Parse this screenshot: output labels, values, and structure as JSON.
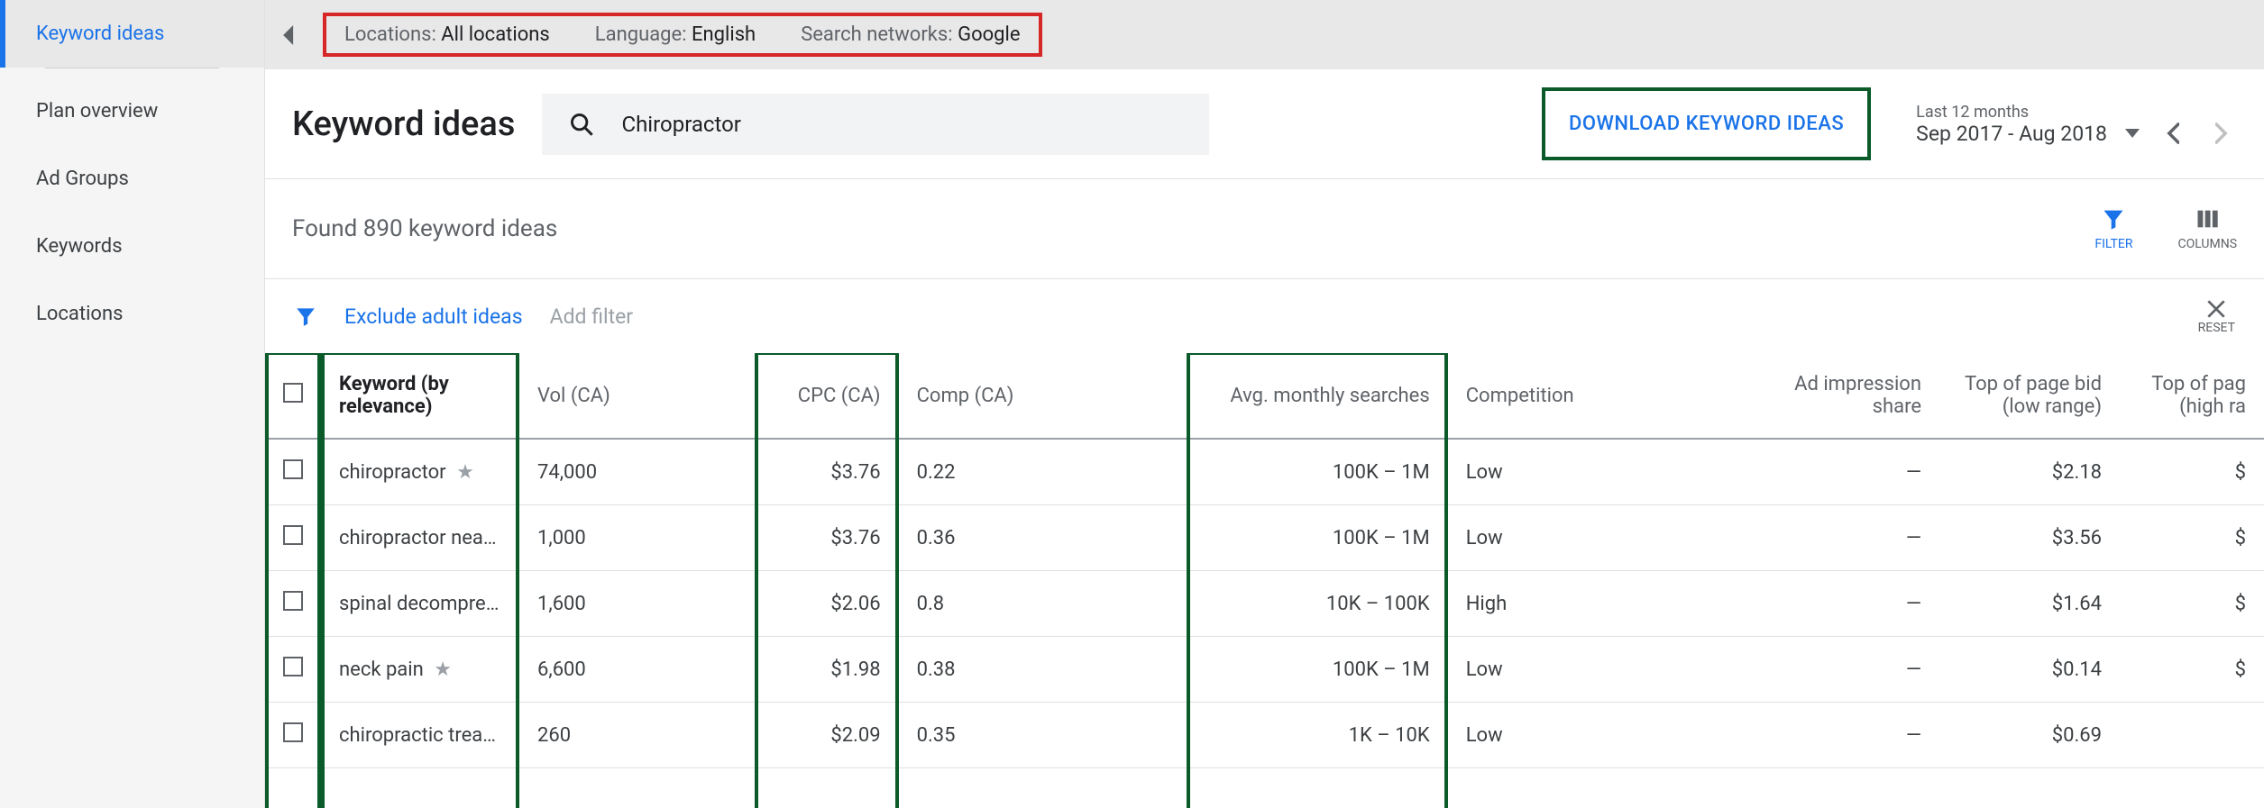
{
  "sidebar": {
    "items": [
      {
        "label": "Keyword ideas",
        "active": true
      },
      {
        "label": "Plan overview"
      },
      {
        "label": "Ad Groups"
      },
      {
        "label": "Keywords"
      },
      {
        "label": "Locations"
      }
    ]
  },
  "topbar": {
    "locations_label": "Locations:",
    "locations_value": "All locations",
    "language_label": "Language:",
    "language_value": "English",
    "networks_label": "Search networks:",
    "networks_value": "Google"
  },
  "header": {
    "page_title": "Keyword ideas",
    "search_value": "Chiropractor",
    "download_label": "DOWNLOAD KEYWORD IDEAS",
    "date_label": "Last 12 months",
    "date_range": "Sep 2017 - Aug 2018"
  },
  "found": {
    "text": "Found 890 keyword ideas",
    "filter_label": "FILTER",
    "columns_label": "COLUMNS"
  },
  "filterbar": {
    "exclude": "Exclude adult ideas",
    "add_filter": "Add filter",
    "reset": "RESET"
  },
  "table": {
    "columns": {
      "keyword": "Keyword (by relevance)",
      "vol": "Vol (CA)",
      "cpc": "CPC (CA)",
      "comp": "Comp (CA)",
      "avg": "Avg. monthly searches",
      "competition": "Competition",
      "impression": "Ad impression share",
      "top_low": "Top of page bid (low range)",
      "top_high": "Top of pag (high ra"
    },
    "rows": [
      {
        "keyword": "chiropractor",
        "star": true,
        "vol": "74,000",
        "cpc": "$3.76",
        "comp": "0.22",
        "avg": "100K – 1M",
        "competition": "Low",
        "impression": "—",
        "top_low": "$2.18",
        "top_high": "$"
      },
      {
        "keyword": "chiropractor near …",
        "star": false,
        "vol": "1,000",
        "cpc": "$3.76",
        "comp": "0.36",
        "avg": "100K – 1M",
        "competition": "Low",
        "impression": "—",
        "top_low": "$3.56",
        "top_high": "$"
      },
      {
        "keyword": "spinal decompres…",
        "star": false,
        "vol": "1,600",
        "cpc": "$2.06",
        "comp": "0.8",
        "avg": "10K – 100K",
        "competition": "High",
        "impression": "—",
        "top_low": "$1.64",
        "top_high": "$"
      },
      {
        "keyword": "neck pain",
        "star": true,
        "vol": "6,600",
        "cpc": "$1.98",
        "comp": "0.38",
        "avg": "100K – 1M",
        "competition": "Low",
        "impression": "—",
        "top_low": "$0.14",
        "top_high": "$"
      },
      {
        "keyword": "chiropractic treat…",
        "star": false,
        "vol": "260",
        "cpc": "$2.09",
        "comp": "0.35",
        "avg": "1K – 10K",
        "competition": "Low",
        "impression": "—",
        "top_low": "$0.69",
        "top_high": ""
      }
    ]
  }
}
